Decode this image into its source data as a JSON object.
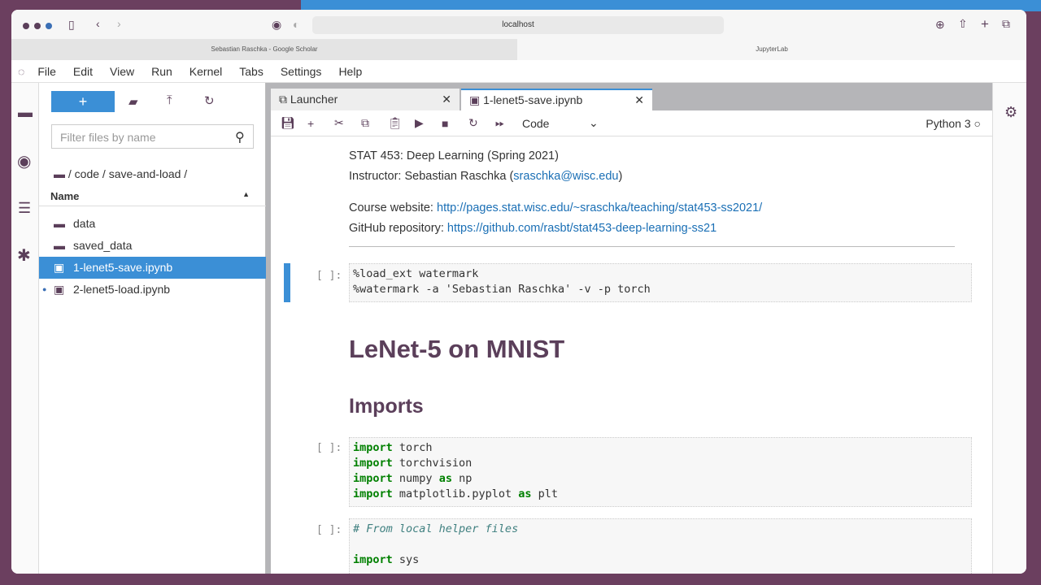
{
  "browser": {
    "url": "localhost",
    "tabs": [
      "Sebastian Raschka - Google Scholar",
      "JupyterLab"
    ]
  },
  "menu": [
    "File",
    "Edit",
    "View",
    "Run",
    "Kernel",
    "Tabs",
    "Settings",
    "Help"
  ],
  "filebrowser": {
    "new_label": "+",
    "filter_placeholder": "Filter files by name",
    "breadcrumb": "/ code / save-and-load /",
    "column": "Name",
    "items": [
      {
        "name": "data",
        "type": "folder"
      },
      {
        "name": "saved_data",
        "type": "folder"
      },
      {
        "name": "1-lenet5-save.ipynb",
        "type": "notebook",
        "selected": true
      },
      {
        "name": "2-lenet5-load.ipynb",
        "type": "notebook"
      }
    ]
  },
  "tabs": [
    {
      "label": "Launcher"
    },
    {
      "label": "1-lenet5-save.ipynb",
      "active": true
    }
  ],
  "toolbar": {
    "cell_type": "Code",
    "kernel": "Python 3"
  },
  "notebook": {
    "course": "STAT 453: Deep Learning (Spring 2021)",
    "instructor_label": "Instructor: Sebastian Raschka (",
    "instructor_email": "sraschka@wisc.edu",
    "instructor_end": ")",
    "website_label": "Course website: ",
    "website_url": "http://pages.stat.wisc.edu/~sraschka/teaching/stat453-ss2021/",
    "github_label": "GitHub repository: ",
    "github_url": "https://github.com/rasbt/stat453-deep-learning-ss21",
    "prompt": "[ ]:",
    "cell1": [
      "%load_ext watermark",
      "%watermark -a 'Sebastian Raschka' -v -p torch"
    ],
    "h1": "LeNet-5 on MNIST",
    "h2": "Imports",
    "cell2": [
      [
        "import",
        " torch"
      ],
      [
        "import",
        " torchvision"
      ],
      [
        "import",
        " numpy ",
        "as",
        " np"
      ],
      [
        "import",
        " matplotlib.pyplot ",
        "as",
        " plt"
      ]
    ],
    "cell3_comment": "# From local helper files",
    "cell3_import": "import",
    "cell3_rest": " sys"
  },
  "colors": {
    "accent": "#3b8fd6",
    "heading": "#5b3f5a",
    "keyword": "#008000"
  }
}
